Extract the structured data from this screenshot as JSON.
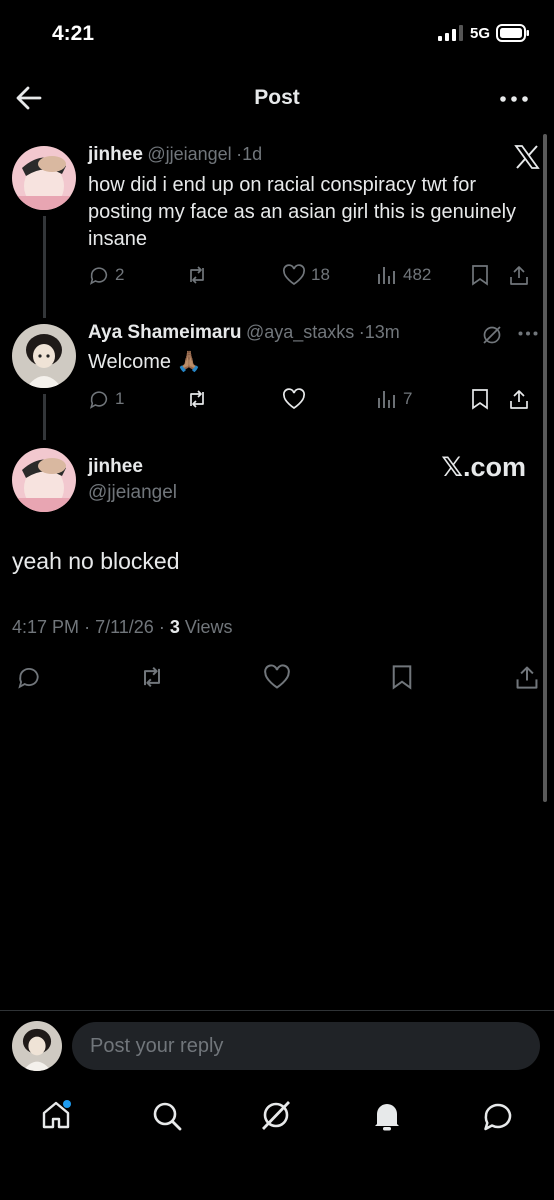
{
  "status_bar": {
    "time": "4:21",
    "network": "5G"
  },
  "header": {
    "title": "Post",
    "back_icon": "arrow-left-icon",
    "more_icon": "more-icon"
  },
  "posts": [
    {
      "name": "jinhee",
      "handle": "@jjeiangel",
      "time": "1d",
      "text": "how did i end up on racial conspiracy twt for posting my face as an asian girl this is genuinely insane",
      "replies": "2",
      "likes": "18",
      "views": "482"
    },
    {
      "name": "Aya Shameimaru",
      "handle": "@aya_staxks",
      "time": "13m",
      "text": "Welcome 🙏🏽",
      "replies": "1",
      "views": "7"
    }
  ],
  "main_post": {
    "name": "jinhee",
    "handle": "@jjeiangel",
    "text": "yeah no blocked",
    "time": "4:17 PM",
    "date": "7/11/26",
    "views_count": "3",
    "views_label": "Views"
  },
  "watermark": "𝕏.com",
  "reply_box": {
    "placeholder": "Post your reply"
  },
  "colors": {
    "background": "#000000",
    "text": "#e7e9ea",
    "muted": "#71767b",
    "accent": "#1d9bf0"
  }
}
